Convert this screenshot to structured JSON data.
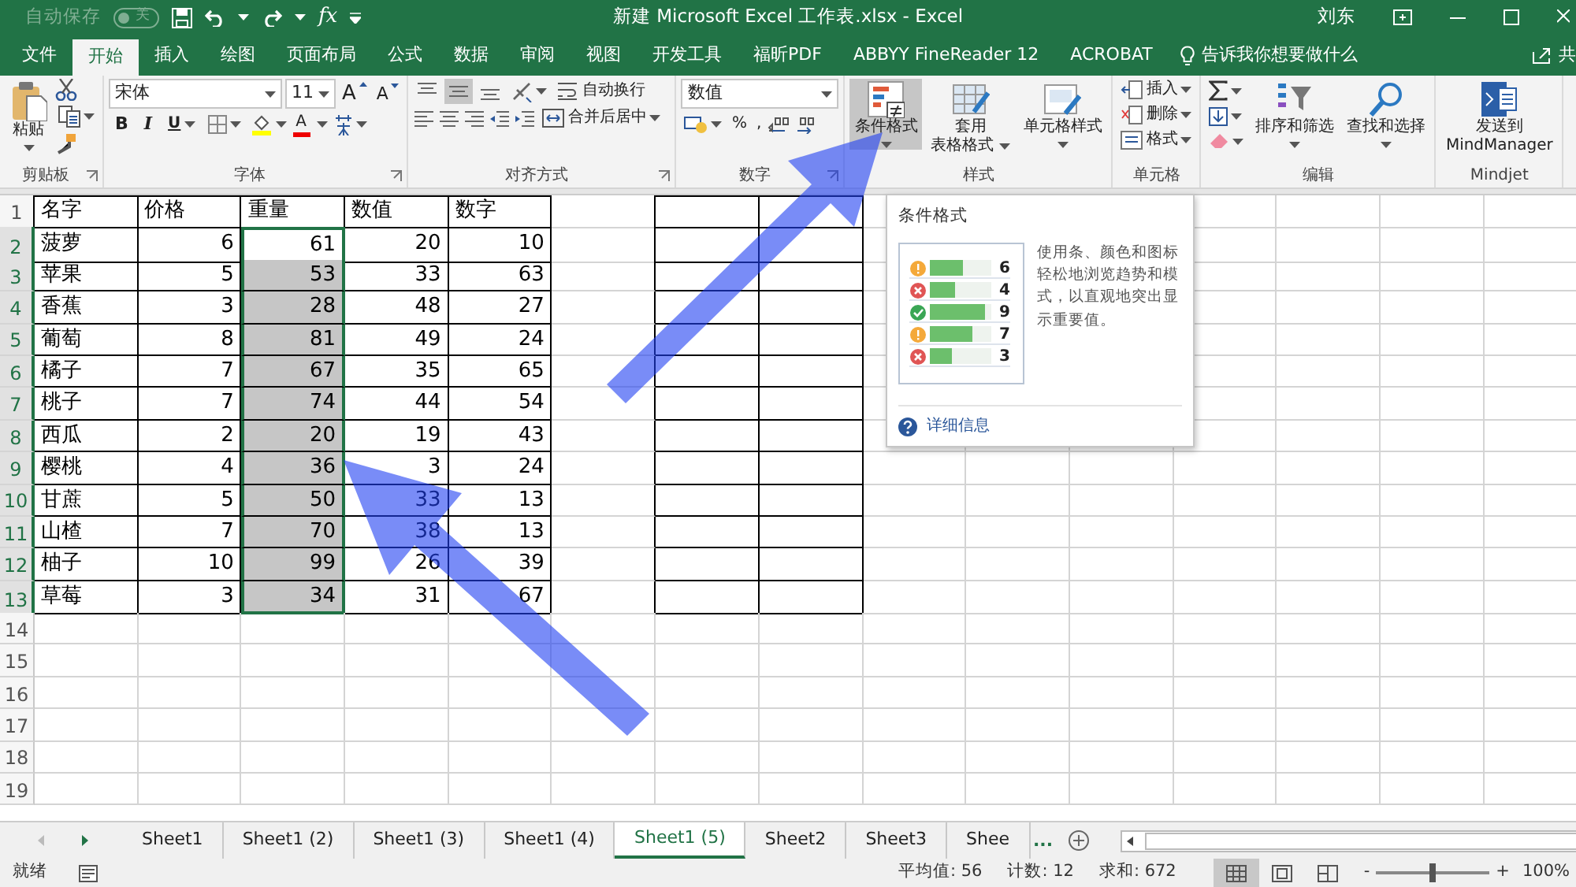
{
  "title_bar": {
    "autosave_label": "自动保存",
    "autosave_toggle": "关",
    "autosave_on": false,
    "formula_button": "fx",
    "title": "新建 Microsoft Excel 工作表.xlsx  -  Excel",
    "user": "刘东"
  },
  "tabs": [
    {
      "label": "文件",
      "selected": false
    },
    {
      "label": "开始",
      "selected": true
    },
    {
      "label": "插入",
      "selected": false
    },
    {
      "label": "绘图",
      "selected": false
    },
    {
      "label": "页面布局",
      "selected": false
    },
    {
      "label": "公式",
      "selected": false
    },
    {
      "label": "数据",
      "selected": false
    },
    {
      "label": "审阅",
      "selected": false
    },
    {
      "label": "视图",
      "selected": false
    },
    {
      "label": "开发工具",
      "selected": false
    },
    {
      "label": "福昕PDF",
      "selected": false
    },
    {
      "label": "ABBYY FineReader 12",
      "selected": false
    },
    {
      "label": "ACROBAT",
      "selected": false
    }
  ],
  "tell_me": "告诉我你想要做什么",
  "share_label": "共",
  "ribbon": {
    "clipboard": {
      "paste": "粘贴",
      "label": "剪贴板"
    },
    "font": {
      "name": "宋体",
      "size": "11",
      "grow": "A",
      "shrink": "A",
      "bold": "B",
      "italic": "I",
      "underline": "U",
      "color_letter": "A",
      "label": "字体"
    },
    "alignment": {
      "vertical": [
        {
          "kind": "top",
          "selected": false
        },
        {
          "kind": "middle",
          "selected": true
        },
        {
          "kind": "bottom",
          "selected": false
        }
      ],
      "wrap": "自动换行",
      "merge": "合并后居中",
      "label": "对齐方式"
    },
    "number": {
      "format": "数值",
      "percent": "%",
      "comma": ",",
      "label": "数字"
    },
    "styles": {
      "buttons": [
        {
          "kind": "conditional",
          "lines": [
            "条件格式"
          ],
          "selected": true,
          "dropdown": true
        },
        {
          "kind": "table",
          "lines": [
            "套用",
            "表格格式"
          ],
          "selected": false,
          "dropdown": true
        },
        {
          "kind": "cell",
          "lines": [
            "单元格样式"
          ],
          "selected": false,
          "dropdown": true
        }
      ],
      "label": "样式"
    },
    "cells": {
      "buttons": [
        {
          "kind": "insert",
          "label": "插入"
        },
        {
          "kind": "delete",
          "label": "删除"
        },
        {
          "kind": "format",
          "label": "格式"
        }
      ],
      "label": "单元格"
    },
    "editing": {
      "buttons": [
        {
          "kind": "sort",
          "lines": [
            "排序和筛选"
          ],
          "dropdown": true
        },
        {
          "kind": "find",
          "lines": [
            "查找和选择"
          ],
          "dropdown": true
        }
      ],
      "label": "编辑"
    },
    "mindjet": {
      "lines": [
        "发送到",
        "MindManager"
      ],
      "dropdown": false,
      "label": "Mindjet"
    }
  },
  "sheet": {
    "rows": [
      {
        "number": "1",
        "bordered": true,
        "cells": [
          {
            "text": "名字",
            "selected": false,
            "shaded": false
          },
          {
            "text": "价格",
            "selected": false,
            "shaded": false
          },
          {
            "text": "重量",
            "selected": false,
            "shaded": false
          },
          {
            "text": "数值",
            "selected": false,
            "shaded": false
          },
          {
            "text": "数字",
            "selected": false,
            "shaded": false
          }
        ]
      },
      {
        "number": "2",
        "bordered": true,
        "cells": [
          {
            "text": "菠萝",
            "selected": false,
            "shaded": false
          },
          {
            "text": "6",
            "selected": false,
            "shaded": false
          },
          {
            "text": "61",
            "selected": true,
            "shaded": false
          },
          {
            "text": "20",
            "selected": false,
            "shaded": false
          },
          {
            "text": "10",
            "selected": false,
            "shaded": false
          }
        ]
      },
      {
        "number": "3",
        "bordered": true,
        "cells": [
          {
            "text": "苹果",
            "selected": false,
            "shaded": false
          },
          {
            "text": "5",
            "selected": false,
            "shaded": false
          },
          {
            "text": "53",
            "selected": true,
            "shaded": true
          },
          {
            "text": "33",
            "selected": false,
            "shaded": false
          },
          {
            "text": "63",
            "selected": false,
            "shaded": false
          }
        ]
      },
      {
        "number": "4",
        "bordered": true,
        "cells": [
          {
            "text": "香蕉",
            "selected": false,
            "shaded": false
          },
          {
            "text": "3",
            "selected": false,
            "shaded": false
          },
          {
            "text": "28",
            "selected": true,
            "shaded": true
          },
          {
            "text": "48",
            "selected": false,
            "shaded": false
          },
          {
            "text": "27",
            "selected": false,
            "shaded": false
          }
        ]
      },
      {
        "number": "5",
        "bordered": true,
        "cells": [
          {
            "text": "葡萄",
            "selected": false,
            "shaded": false
          },
          {
            "text": "8",
            "selected": false,
            "shaded": false
          },
          {
            "text": "81",
            "selected": true,
            "shaded": true
          },
          {
            "text": "49",
            "selected": false,
            "shaded": false
          },
          {
            "text": "24",
            "selected": false,
            "shaded": false
          }
        ]
      },
      {
        "number": "6",
        "bordered": true,
        "cells": [
          {
            "text": "橘子",
            "selected": false,
            "shaded": false
          },
          {
            "text": "7",
            "selected": false,
            "shaded": false
          },
          {
            "text": "67",
            "selected": true,
            "shaded": true
          },
          {
            "text": "35",
            "selected": false,
            "shaded": false
          },
          {
            "text": "65",
            "selected": false,
            "shaded": false
          }
        ]
      },
      {
        "number": "7",
        "bordered": true,
        "cells": [
          {
            "text": "桃子",
            "selected": false,
            "shaded": false
          },
          {
            "text": "7",
            "selected": false,
            "shaded": false
          },
          {
            "text": "74",
            "selected": true,
            "shaded": true
          },
          {
            "text": "44",
            "selected": false,
            "shaded": false
          },
          {
            "text": "54",
            "selected": false,
            "shaded": false
          }
        ]
      },
      {
        "number": "8",
        "bordered": true,
        "cells": [
          {
            "text": "西瓜",
            "selected": false,
            "shaded": false
          },
          {
            "text": "2",
            "selected": false,
            "shaded": false
          },
          {
            "text": "20",
            "selected": true,
            "shaded": true
          },
          {
            "text": "19",
            "selected": false,
            "shaded": false
          },
          {
            "text": "43",
            "selected": false,
            "shaded": false
          }
        ]
      },
      {
        "number": "9",
        "bordered": true,
        "cells": [
          {
            "text": "樱桃",
            "selected": false,
            "shaded": false
          },
          {
            "text": "4",
            "selected": false,
            "shaded": false
          },
          {
            "text": "36",
            "selected": true,
            "shaded": true
          },
          {
            "text": "3",
            "selected": false,
            "shaded": false
          },
          {
            "text": "24",
            "selected": false,
            "shaded": false
          }
        ]
      },
      {
        "number": "10",
        "bordered": true,
        "cells": [
          {
            "text": "甘蔗",
            "selected": false,
            "shaded": false
          },
          {
            "text": "5",
            "selected": false,
            "shaded": false
          },
          {
            "text": "50",
            "selected": true,
            "shaded": true
          },
          {
            "text": "33",
            "selected": false,
            "shaded": false
          },
          {
            "text": "13",
            "selected": false,
            "shaded": false
          }
        ]
      },
      {
        "number": "11",
        "bordered": true,
        "cells": [
          {
            "text": "山楂",
            "selected": false,
            "shaded": false
          },
          {
            "text": "7",
            "selected": false,
            "shaded": false
          },
          {
            "text": "70",
            "selected": true,
            "shaded": true
          },
          {
            "text": "38",
            "selected": false,
            "shaded": false
          },
          {
            "text": "13",
            "selected": false,
            "shaded": false
          }
        ]
      },
      {
        "number": "12",
        "bordered": true,
        "cells": [
          {
            "text": "柚子",
            "selected": false,
            "shaded": false
          },
          {
            "text": "10",
            "selected": false,
            "shaded": false
          },
          {
            "text": "99",
            "selected": true,
            "shaded": true
          },
          {
            "text": "26",
            "selected": false,
            "shaded": false
          },
          {
            "text": "39",
            "selected": false,
            "shaded": false
          }
        ]
      },
      {
        "number": "13",
        "bordered": true,
        "cells": [
          {
            "text": "草莓",
            "selected": false,
            "shaded": false
          },
          {
            "text": "3",
            "selected": false,
            "shaded": false
          },
          {
            "text": "34",
            "selected": true,
            "shaded": true
          },
          {
            "text": "31",
            "selected": false,
            "shaded": false
          },
          {
            "text": "67",
            "selected": false,
            "shaded": false
          }
        ]
      },
      {
        "number": "14",
        "bordered": false
      },
      {
        "number": "15",
        "bordered": false
      },
      {
        "number": "16",
        "bordered": false
      },
      {
        "number": "17",
        "bordered": false
      },
      {
        "number": "18",
        "bordered": false
      },
      {
        "number": "19",
        "bordered": false
      }
    ]
  },
  "tooltip": {
    "title": "条件格式",
    "preview": [
      {
        "kind": "warning",
        "level": 0.55,
        "value": "6"
      },
      {
        "kind": "error",
        "level": 0.4,
        "value": "4"
      },
      {
        "kind": "ok",
        "level": 0.9,
        "value": "9"
      },
      {
        "kind": "warning",
        "level": 0.7,
        "value": "7"
      },
      {
        "kind": "error",
        "level": 0.35,
        "value": "3"
      }
    ],
    "description": "使用条、颜色和图标轻松地浏览趋势和模式，以直观地突出显示重要值。",
    "help": "详细信息"
  },
  "sheet_tabs": [
    {
      "label": "Sheet1",
      "selected": false
    },
    {
      "label": "Sheet1 (2)",
      "selected": false
    },
    {
      "label": "Sheet1 (3)",
      "selected": false
    },
    {
      "label": "Sheet1 (4)",
      "selected": false
    },
    {
      "label": "Sheet1 (5)",
      "selected": true
    },
    {
      "label": "Sheet2",
      "selected": false
    },
    {
      "label": "Sheet3",
      "selected": false
    },
    {
      "label": "Shee",
      "selected": false
    }
  ],
  "more_tabs": "...",
  "status": {
    "ready": "就绪",
    "average": "平均值: 56",
    "count": "计数: 12",
    "sum": "求和: 672",
    "views": [
      {
        "kind": "normal",
        "selected": true
      },
      {
        "kind": "page_layout",
        "selected": false
      },
      {
        "kind": "page_break",
        "selected": false
      }
    ],
    "zoom_minus": "-",
    "zoom_plus": "+",
    "zoom": {
      "level": 0.5
    },
    "zoom_text": "100%"
  },
  "annotations": [
    {
      "kind": "pointer"
    },
    {
      "kind": "pointer"
    }
  ]
}
